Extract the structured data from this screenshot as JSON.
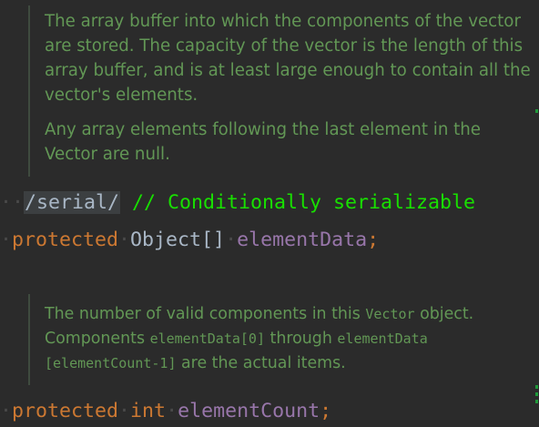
{
  "doc1": {
    "paragraph1": "The array buffer into which the components of the vector are stored. The capacity of the vector is the length of this array buffer, and is at least large enough to contain all the vector's elements.",
    "paragraph2": "Any array elements following the last element in the Vector are null."
  },
  "line1": {
    "leading_dots": "··",
    "serial_tag": "/serial/",
    "comment": "// Conditionally serializable"
  },
  "line2": {
    "leading_dot": "·",
    "keyword": "protected",
    "type": "Object[]",
    "field": "elementData",
    "terminator": ";"
  },
  "doc2": {
    "t1": "The number of valid components in this ",
    "c1": "Vector",
    "t2": " object. Components ",
    "c2": "elementData[0]",
    "t3": " through ",
    "c3": "elementData [elementCount-1]",
    "t4": " are the actual items."
  },
  "line3": {
    "leading_dot": "·",
    "keyword": "protected",
    "type": "int",
    "field": "elementCount",
    "terminator": ";"
  },
  "colors": {
    "background": "#2b2b2b",
    "doc_text": "#629755",
    "keyword": "#cc7832",
    "field": "#9876aa",
    "comment": "#18e000",
    "plain": "#a9b7c6"
  }
}
